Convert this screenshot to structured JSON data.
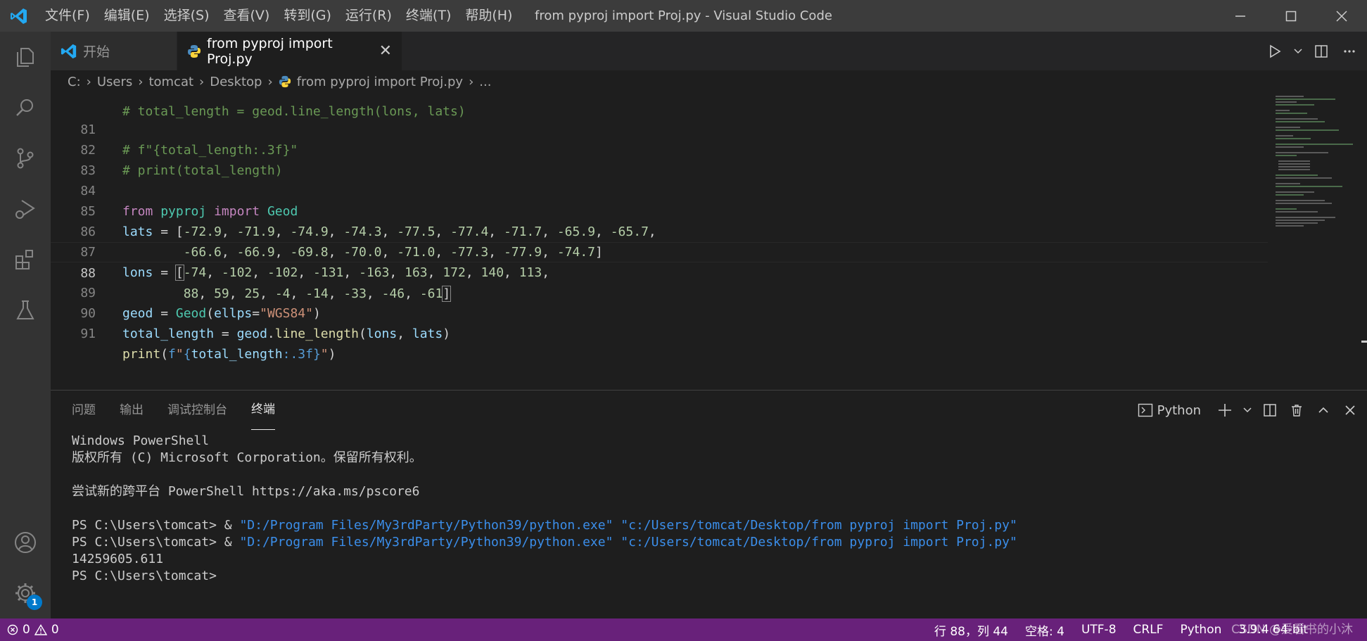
{
  "titlebar": {
    "menu": [
      "文件(F)",
      "编辑(E)",
      "选择(S)",
      "查看(V)",
      "转到(G)",
      "运行(R)",
      "终端(T)",
      "帮助(H)"
    ],
    "window_title": "from pyproj import Proj.py - Visual Studio Code"
  },
  "activitybar": {
    "icons": [
      "explorer-icon",
      "search-icon",
      "source-control-icon",
      "run-debug-icon",
      "extensions-icon",
      "testing-icon",
      "account-icon",
      "settings-gear-icon"
    ],
    "settings_badge": "1"
  },
  "tabs": [
    {
      "label": "开始",
      "active": false
    },
    {
      "label": "from pyproj import Proj.py",
      "active": true
    }
  ],
  "breadcrumb": [
    "C:",
    "Users",
    "tomcat",
    "Desktop",
    "from pyproj import Proj.py",
    "..."
  ],
  "editor": {
    "partial_top_line": "# total_length = geod.line_length(lons, lats)",
    "line_numbers": [
      "81",
      "82",
      "83",
      "84",
      "85",
      "86",
      "87",
      "88",
      "89",
      "90",
      "91"
    ],
    "current_line": "88"
  },
  "panel": {
    "tabs": [
      "问题",
      "输出",
      "调试控制台",
      "终端"
    ],
    "active_tab": "终端",
    "terminal_name": "Python",
    "terminal": {
      "line1": "Windows PowerShell",
      "line2": "版权所有 (C) Microsoft Corporation。保留所有权利。",
      "line3": "尝试新的跨平台 PowerShell https://aka.ms/pscore6",
      "prompt": "PS C:\\Users\\tomcat> ",
      "cmd_amp": "& ",
      "cmd_exe": "\"D:/Program Files/My3rdParty/Python39/python.exe\"",
      "cmd_script": "\"c:/Users/tomcat/Desktop/from pyproj import Proj.py\"",
      "output": "14259605.611",
      "final_prompt": "PS C:\\Users\\tomcat>"
    }
  },
  "statusbar": {
    "errors": "0",
    "warnings": "0",
    "position": "行 88，列 44",
    "spaces": "空格: 4",
    "encoding": "UTF-8",
    "eol": "CRLF",
    "language": "Python",
    "interpreter": "3.9.4 64-bit",
    "watermark": "CSDN @爱看书的小沐"
  },
  "colors": {
    "statusbar_bg": "#68217a",
    "titlebar_bg": "#3c3c3c",
    "editor_bg": "#1e1e1e",
    "accent": "#007acc"
  }
}
